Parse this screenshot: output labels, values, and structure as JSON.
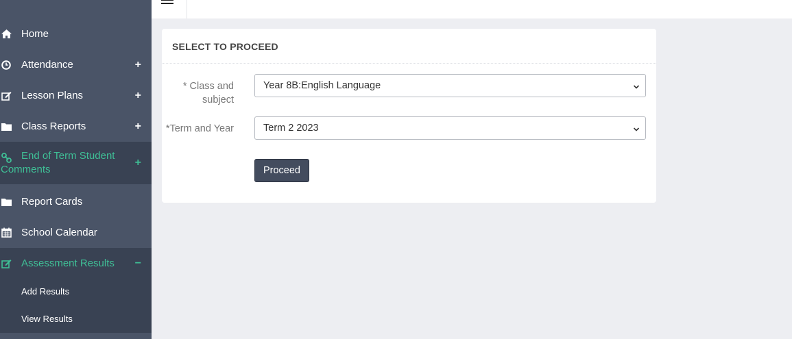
{
  "sidebar": {
    "items": [
      {
        "label": "Home",
        "icon": "home-icon"
      },
      {
        "label": "Attendance",
        "icon": "clock-icon",
        "expander": "+"
      },
      {
        "label": "Lesson Plans",
        "icon": "edit-icon",
        "expander": "+"
      },
      {
        "label": "Class Reports",
        "icon": "folder-icon",
        "expander": "+"
      },
      {
        "label": "End of Term Student Comments",
        "icon": "link-icon",
        "expander": "+"
      },
      {
        "label": "Report Cards",
        "icon": "folder-icon"
      },
      {
        "label": "School Calendar",
        "icon": "calendar-icon"
      },
      {
        "label": "Assessment Results",
        "icon": "edit-icon",
        "expander": "−"
      }
    ],
    "subitems": [
      {
        "label": "Add Results"
      },
      {
        "label": "View Results"
      }
    ]
  },
  "card": {
    "title": "SELECT TO PROCEED",
    "class_label": "* Class and subject",
    "class_value": "Year 8B:English Language",
    "term_label": "*Term and Year",
    "term_value": "Term 2 2023",
    "proceed_label": "Proceed"
  },
  "colors": {
    "sidebar_bg": "#4a5467",
    "sidebar_active_bg": "#394253",
    "accent": "#3fbf96",
    "button_bg": "#434c5e"
  }
}
